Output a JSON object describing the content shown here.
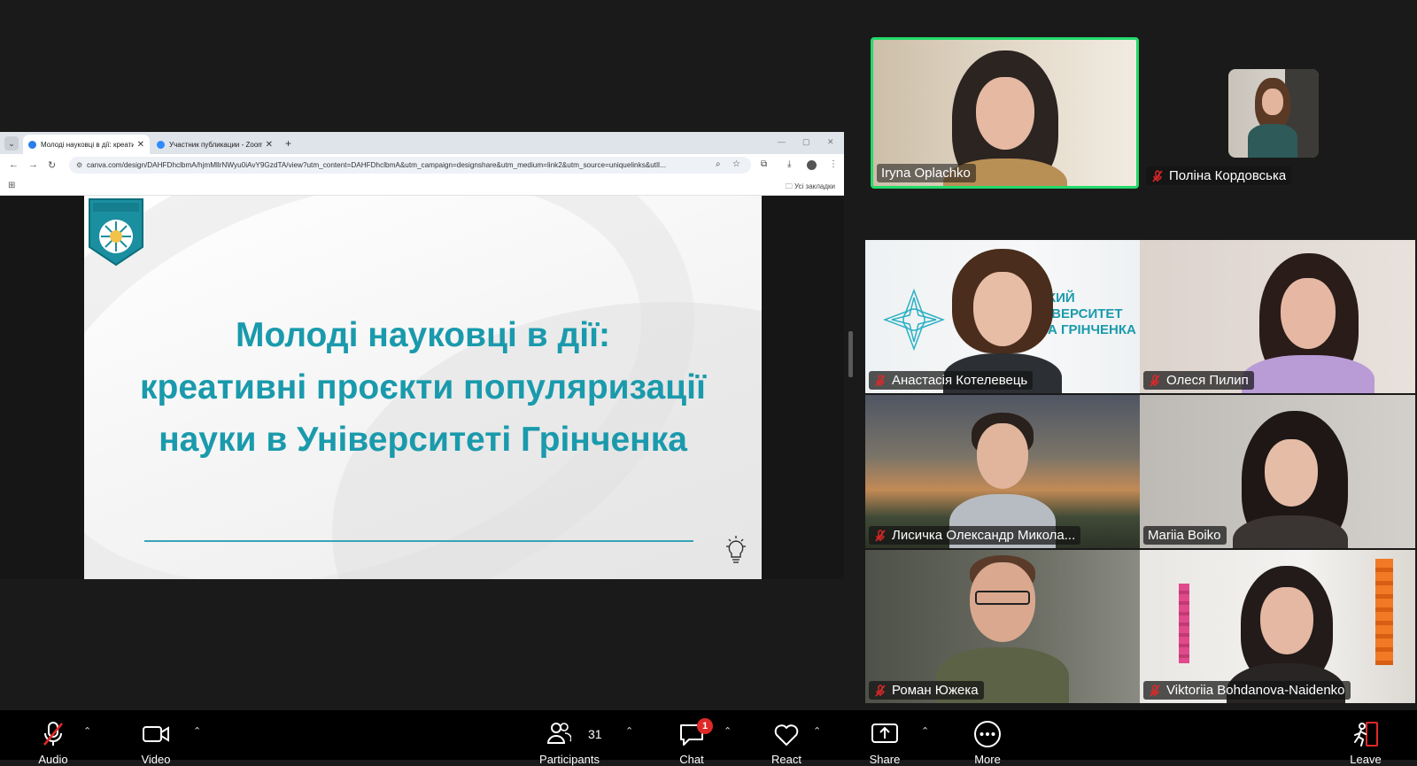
{
  "shared_screen": {
    "browser": {
      "tabs": [
        {
          "title": "Молоді науковці в дії: креати",
          "active": true
        },
        {
          "title": "Участник публикации - Zoom",
          "active": false
        }
      ],
      "new_tab": "+",
      "url": "canva.com/design/DAHFDhclbmA/hjmMllrNWyu0iAvY9GzdTA/view?utm_content=DAHFDhclbmA&utm_campaign=designshare&utm_medium=link2&utm_source=uniquelinks&utlI...",
      "bookmarks_all": "Усі закладки"
    },
    "slide": {
      "title_lines": [
        "Молоді науковці в дії:",
        "креативні проєкти популяризації",
        "науки в Університеті Грінченка"
      ],
      "accent_color": "#1a9aac"
    }
  },
  "participants": [
    {
      "name": "Iryna Oplachko",
      "muted": false,
      "active_speaker": true
    },
    {
      "name": "Поліна Кордовська",
      "muted": true
    },
    {
      "name": "Анастасія Котелевець",
      "muted": true
    },
    {
      "name": "Олеся Пилип",
      "muted": true
    },
    {
      "name": "Лисичка Олександр Микола...",
      "muted": true
    },
    {
      "name": "Mariia Boiko",
      "muted": false
    },
    {
      "name": "Роман Южека",
      "muted": true
    },
    {
      "name": "Viktoriia Bohdanova-Naidenko",
      "muted": true
    }
  ],
  "tile_logo_text": {
    "line1": "КИЙ",
    "line2": "ІВЕРСИТЕТ",
    "line3": "А ГРІНЧЕНКА"
  },
  "toolbar": {
    "audio": "Audio",
    "video": "Video",
    "participants": "Participants",
    "participants_count": "31",
    "chat": "Chat",
    "chat_badge": "1",
    "react": "React",
    "share": "Share",
    "more": "More",
    "leave": "Leave"
  },
  "colors": {
    "active_speaker": "#23d96b",
    "mute": "#e02828",
    "leave": "#e02828"
  }
}
